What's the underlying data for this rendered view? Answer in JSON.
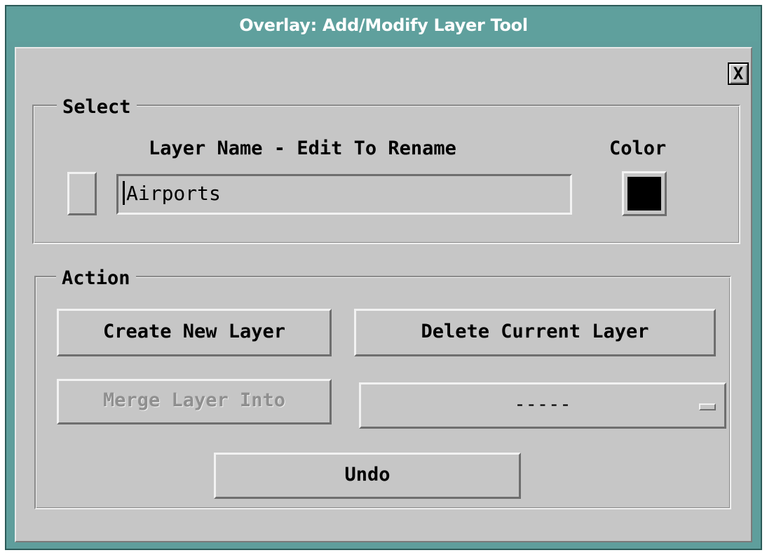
{
  "window": {
    "title": "Overlay: Add/Modify Layer Tool",
    "close_label": "X"
  },
  "select_group": {
    "legend": "Select",
    "layer_name_header": "Layer Name - Edit To Rename",
    "color_header": "Color",
    "layer_name_value": "Airports",
    "layer_color": "#000000"
  },
  "action_group": {
    "legend": "Action",
    "create_label": "Create New Layer",
    "delete_label": "Delete Current Layer",
    "merge_label": "Merge Layer Into",
    "merge_target_value": "-----",
    "undo_label": "Undo"
  },
  "colors": {
    "titlebar": "#5fa09d",
    "dialog_background": "#c6c6c6"
  }
}
